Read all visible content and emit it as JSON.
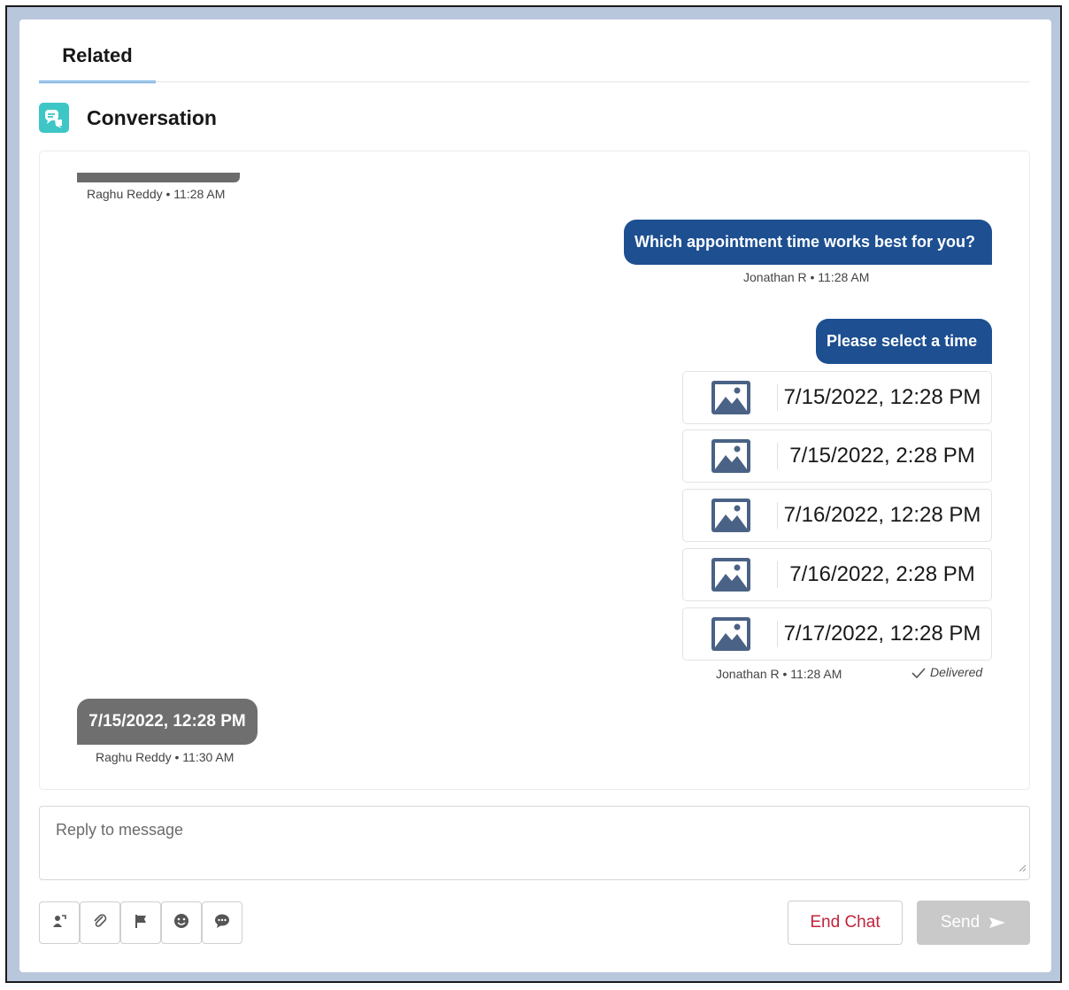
{
  "tab": {
    "label": "Related"
  },
  "conversation": {
    "title": "Conversation",
    "icon": "chat-bubbles-icon",
    "accent_color": "#3ec6c6"
  },
  "messages": [
    {
      "type": "incoming-truncated",
      "meta": "Raghu Reddy • 11:28 AM"
    },
    {
      "type": "outgoing",
      "text": "Which appointment time works best for you?",
      "meta": "Jonathan R • 11:28 AM"
    },
    {
      "type": "outgoing-options",
      "text": "Please select a time",
      "options": [
        {
          "label": "7/15/2022, 12:28 PM",
          "icon": "image-icon"
        },
        {
          "label": "7/15/2022, 2:28 PM",
          "icon": "image-icon"
        },
        {
          "label": "7/16/2022, 12:28 PM",
          "icon": "image-icon"
        },
        {
          "label": "7/16/2022, 2:28 PM",
          "icon": "image-icon"
        },
        {
          "label": "7/17/2022, 12:28 PM",
          "icon": "image-icon"
        }
      ],
      "meta": "Jonathan R • 11:28 AM",
      "status": "Delivered"
    },
    {
      "type": "incoming",
      "text": "7/15/2022, 12:28 PM",
      "meta": "Raghu Reddy • 11:30 AM"
    }
  ],
  "reply": {
    "placeholder": "Reply to message"
  },
  "toolbar": {
    "tools": [
      "transfer-icon",
      "attachment-icon",
      "flag-icon",
      "emoji-icon",
      "quick-text-icon"
    ]
  },
  "actions": {
    "end_chat": "End Chat",
    "send": "Send"
  },
  "colors": {
    "outgoing_bubble": "#1d4f91",
    "incoming_bubble": "#6f6f6f",
    "end_chat_text": "#c0233b",
    "send_disabled": "#c9c9c9"
  }
}
